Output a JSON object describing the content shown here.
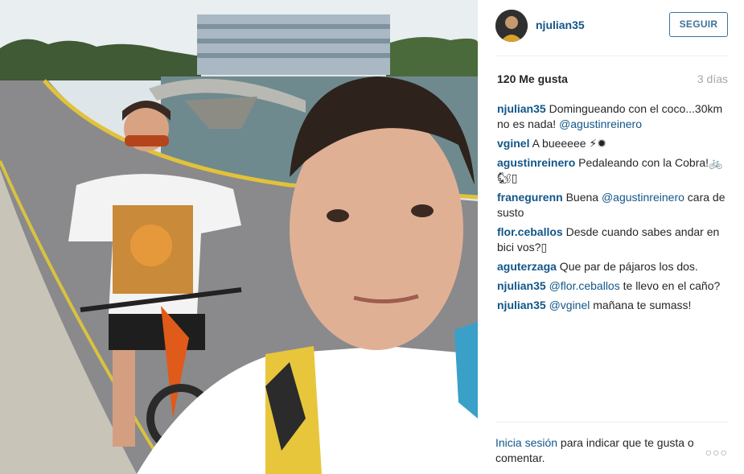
{
  "post": {
    "photo_alt": "Selfie de dos jóvenes en bicicleta sobre un puente"
  },
  "header": {
    "username": "njulian35",
    "follow_label": "SEGUIR"
  },
  "stats": {
    "likes": "120 Me gusta",
    "time_ago": "3 días"
  },
  "comments": [
    {
      "user": "njulian35",
      "text": " Domingueando con el coco...30km no es nada! ",
      "mention": "@agustinreinero",
      "text_after": ""
    },
    {
      "user": "vginel",
      "text": " A bueeeee ⚡✹",
      "mention": "",
      "text_after": ""
    },
    {
      "user": "agustinreinero",
      "text": " Pedaleando con la Cobra!🚲🐿▯",
      "mention": "",
      "text_after": ""
    },
    {
      "user": "franegurenn",
      "text": " Buena ",
      "mention": "@agustinreinero",
      "text_after": " cara de susto"
    },
    {
      "user": "flor.ceballos",
      "text": " Desde cuando sabes andar en bici vos?▯",
      "mention": "",
      "text_after": ""
    },
    {
      "user": "aguterzaga",
      "text": " Que par de pájaros los dos.",
      "mention": "",
      "text_after": ""
    },
    {
      "user": "njulian35",
      "text": " ",
      "mention": "@flor.ceballos",
      "text_after": " te llevo en el caño?"
    },
    {
      "user": "njulian35",
      "text": " ",
      "mention": "@vginel",
      "text_after": " mañana te sumass!"
    }
  ],
  "footer": {
    "login_label": "Inicia sesión",
    "prompt_text": " para indicar que te gusta o comentar.",
    "more_label": "○○○"
  }
}
